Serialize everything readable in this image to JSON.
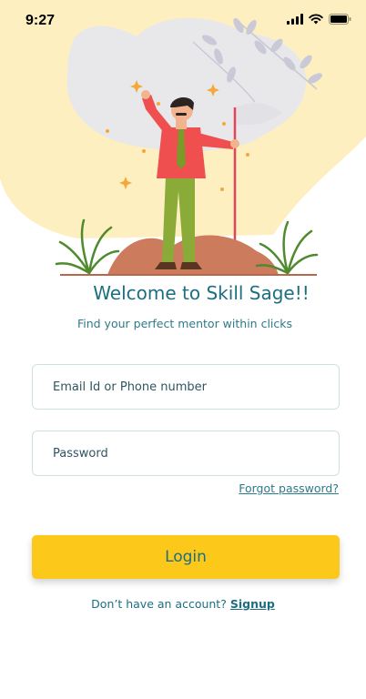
{
  "status_bar": {
    "time": "9:27"
  },
  "welcome": {
    "title": "Welcome to Skill Sage!!",
    "subtitle": "Find your perfect mentor within clicks"
  },
  "form": {
    "email_placeholder": "Email Id or Phone number",
    "password_placeholder": "Password",
    "forgot_label": "Forgot password?",
    "login_label": "Login"
  },
  "signup": {
    "prompt": "Don’t have an account?",
    "link_label": "Signup"
  },
  "colors": {
    "brand_teal": "#1d6e82",
    "button_yellow": "#fcc819",
    "hero_bg": "#fdefc0"
  },
  "icons": [
    "signal-icon",
    "wifi-icon",
    "battery-icon"
  ]
}
